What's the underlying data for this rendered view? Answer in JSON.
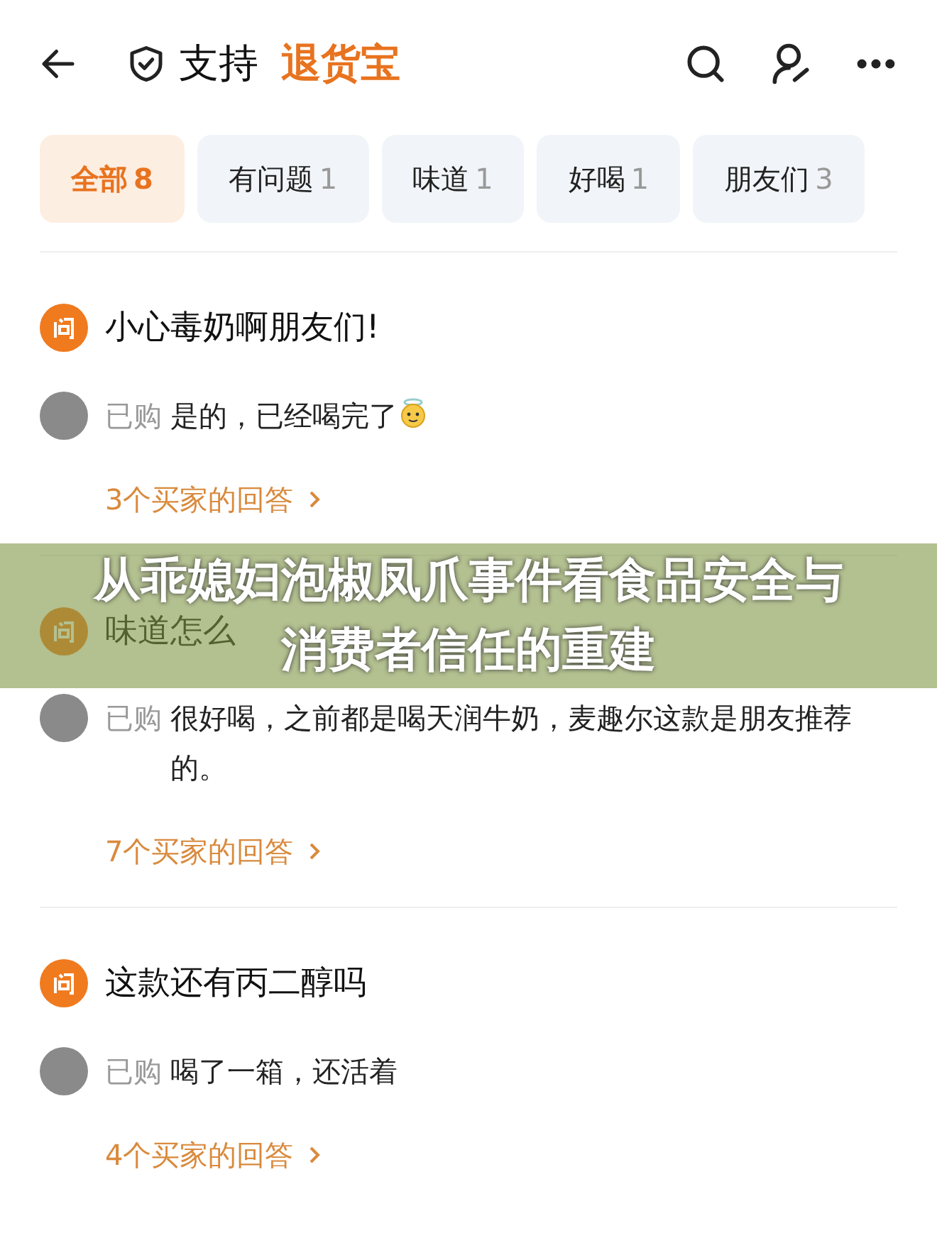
{
  "header": {
    "badge": "支持",
    "brand": "退货宝"
  },
  "tabs": [
    {
      "label": "全部",
      "count": "8",
      "selected": true
    },
    {
      "label": "有问题",
      "count": "1",
      "selected": false
    },
    {
      "label": "味道",
      "count": "1",
      "selected": false
    },
    {
      "label": "好喝",
      "count": "1",
      "selected": false
    },
    {
      "label": "朋友们",
      "count": "3",
      "selected": false
    }
  ],
  "questions": [
    {
      "question": "小心毒奶啊朋友们!",
      "answer": {
        "tag": "已购",
        "text": "是的，已经喝完了",
        "has_emoji": true
      },
      "link": "3个买家的回答"
    },
    {
      "question": "味道怎么",
      "answer": {
        "tag": "已购",
        "text": "很好喝，之前都是喝天润牛奶，麦趣尔这款是朋友推荐的。",
        "has_emoji": false
      },
      "link": "7个买家的回答"
    },
    {
      "question": "这款还有丙二醇吗",
      "answer": {
        "tag": "已购",
        "text": "喝了一箱，还活着",
        "has_emoji": false
      },
      "link": "4个买家的回答"
    }
  ],
  "banner": {
    "title_lines": [
      "从乖媳妇泡椒凤爪事件看食品安全与",
      "消费者信任的重建"
    ]
  }
}
